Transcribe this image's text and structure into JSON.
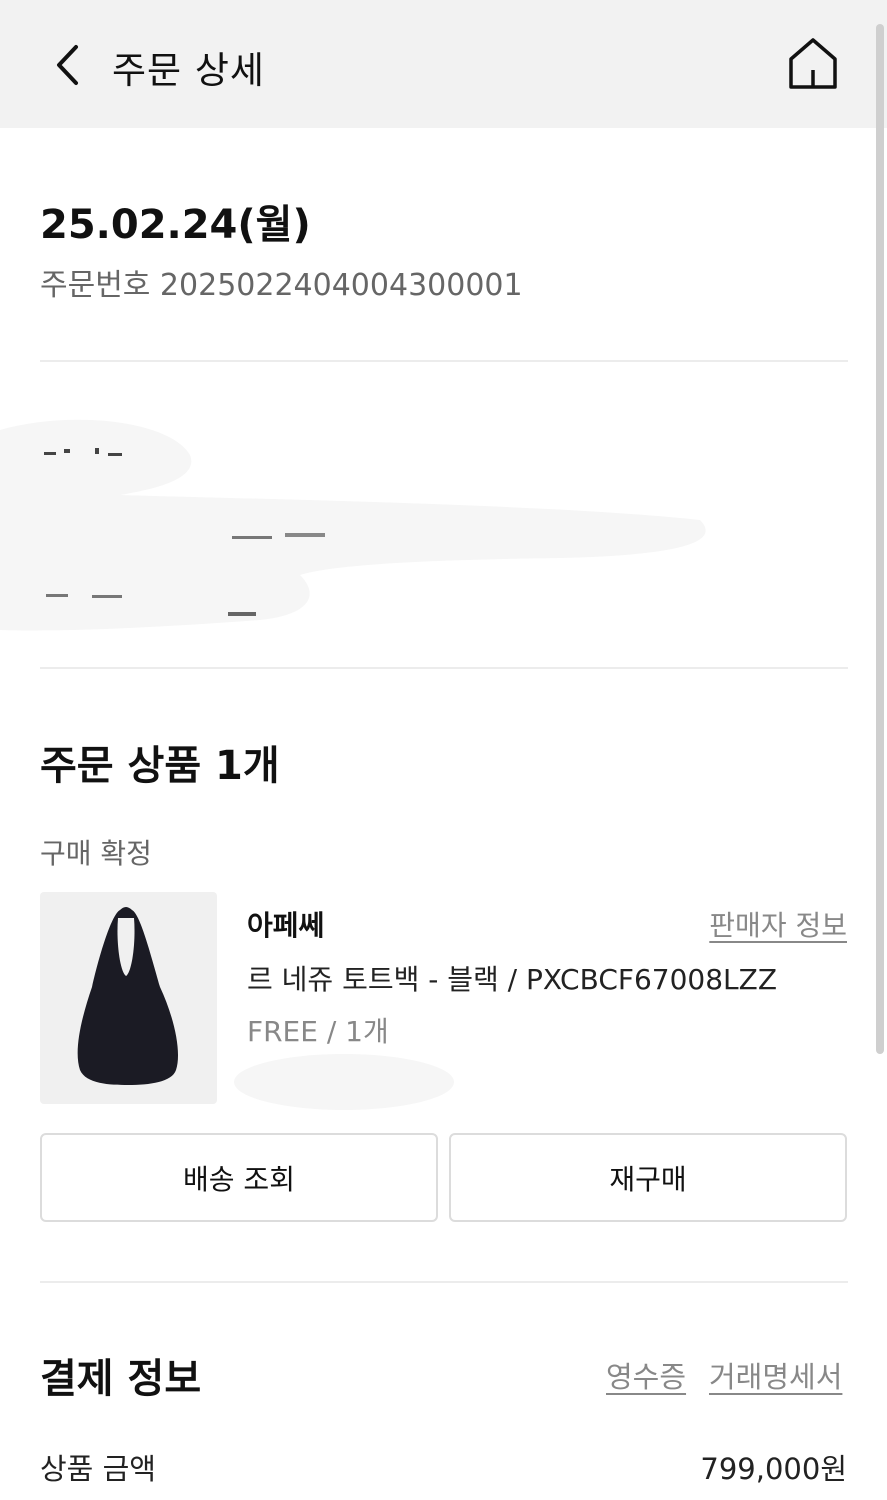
{
  "header": {
    "title": "주문 상세"
  },
  "order": {
    "date": "25.02.24(월)",
    "number_label": "주문번호 2025022404004300001"
  },
  "products_section": {
    "title": "주문 상품 1개",
    "status": "구매 확정",
    "item": {
      "brand": "아페쎄",
      "seller_info_link": "판매자 정보",
      "name": "르 네쥬 토트백 - 블랙 / PXCBCF67008LZZ",
      "option": "FREE / 1개",
      "image_alt": "black tote bag"
    },
    "buttons": {
      "track_shipping": "배송 조회",
      "rebuy": "재구매"
    }
  },
  "payment_section": {
    "title": "결제 정보",
    "receipt_link": "영수증",
    "statement_link": "거래명세서",
    "rows": [
      {
        "label": "상품 금액",
        "value": "799,000원"
      }
    ]
  },
  "icons": {
    "back": "chevron-left-icon",
    "home": "home-icon"
  }
}
